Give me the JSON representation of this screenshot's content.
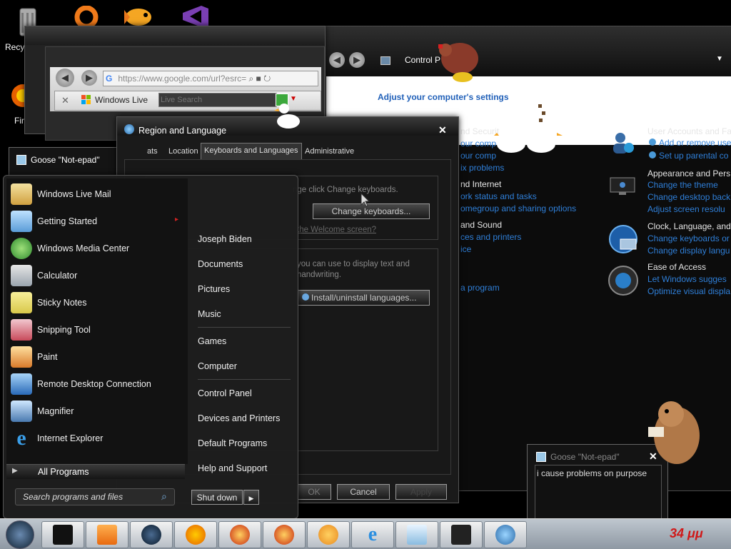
{
  "desktop": {
    "icons": [
      {
        "name": "recycle-bin-icon",
        "label": "Recy"
      },
      {
        "name": "firefox-icon",
        "label": "Fir"
      }
    ]
  },
  "control_panel": {
    "address": "Control P",
    "heading": "Adjust your computer's settings",
    "sections": [
      {
        "title": "nd Security",
        "links": [
          "our comp",
          "our comp",
          "ix problems"
        ]
      },
      {
        "title": "nd Internet",
        "links": [
          "ork status and tasks",
          "omegroup and sharing options"
        ]
      },
      {
        "title": "and Sound",
        "links": [
          "ces and printers",
          "ice"
        ]
      },
      {
        "title": "",
        "links": [
          "a program"
        ]
      }
    ],
    "right_sections": [
      {
        "title": "User Accounts and Fa",
        "links": [
          "Add or remove use",
          "Set up parental co"
        ]
      },
      {
        "title": "Appearance and Pers",
        "links": [
          "Change the theme",
          "Change desktop back",
          "Adjust screen resolu"
        ]
      },
      {
        "title": "Clock, Language, and",
        "links": [
          "Change keyboards or",
          "Change display langu"
        ]
      },
      {
        "title": "Ease of Access",
        "links": [
          "Let Windows sugges",
          "Optimize visual displa"
        ]
      }
    ]
  },
  "browser": {
    "url": "https://www.google.com/url?esrc=",
    "tab_label": "Windows Live",
    "search_placeholder": "Live Search"
  },
  "region_dialog": {
    "title": "Region and Language",
    "tabs": [
      "ats",
      "Location",
      "Keyboards and Languages",
      "Administrative"
    ],
    "text1": "nge click Change keyboards.",
    "change_keyboards": "Change keyboards...",
    "welcome_link": "the Welcome screen?",
    "text2": "you can use to display text and",
    "text3": "handwriting.",
    "install_button": "Install/uninstall languages...",
    "ok": "OK",
    "cancel": "Cancel",
    "apply": "Apply"
  },
  "goose_small": {
    "title": "Goose \"Not-epad\""
  },
  "goose_notepad": {
    "title": "Goose \"Not-epad\"",
    "content": "i cause problems on purpose"
  },
  "start_menu": {
    "left_items": [
      {
        "icon": "mail-icon",
        "label": "Windows Live Mail"
      },
      {
        "icon": "getting-started-icon",
        "label": "Getting Started"
      },
      {
        "icon": "media-center-icon",
        "label": "Windows Media Center"
      },
      {
        "icon": "calculator-icon",
        "label": "Calculator"
      },
      {
        "icon": "sticky-notes-icon",
        "label": "Sticky Notes"
      },
      {
        "icon": "snipping-tool-icon",
        "label": "Snipping Tool"
      },
      {
        "icon": "paint-icon",
        "label": "Paint"
      },
      {
        "icon": "remote-desktop-icon",
        "label": "Remote Desktop Connection"
      },
      {
        "icon": "magnifier-icon",
        "label": "Magnifier"
      },
      {
        "icon": "internet-explorer-icon",
        "label": "Internet Explorer"
      }
    ],
    "all_programs": "All Programs",
    "search_placeholder": "Search programs and files",
    "right_items": [
      "Joseph Biden",
      "Documents",
      "Pictures",
      "Music",
      "Games",
      "Computer",
      "Control Panel",
      "Devices and Printers",
      "Default Programs",
      "Help and Support"
    ],
    "shutdown": "Shut down"
  },
  "taskbar": {
    "clock": "34 μμ",
    "buttons": [
      "explorer-icon",
      "media-player-icon",
      "globe-icon",
      "firefox-icon",
      "pinball-icon",
      "pinball-icon",
      "goldfish-icon",
      "internet-explorer-icon",
      "notepad-icon",
      "window-icon",
      "network-globe-icon"
    ]
  }
}
